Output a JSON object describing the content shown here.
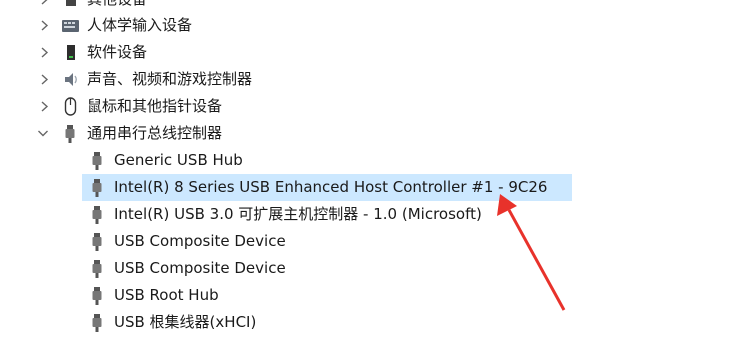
{
  "tree": {
    "categories": [
      {
        "label": "其他设备",
        "expanded": false,
        "icon": "device-icon"
      },
      {
        "label": "人体学输入设备",
        "expanded": false,
        "icon": "keyboard-icon"
      },
      {
        "label": "软件设备",
        "expanded": false,
        "icon": "software-device-icon"
      },
      {
        "label": "声音、视频和游戏控制器",
        "expanded": false,
        "icon": "speaker-icon"
      },
      {
        "label": "鼠标和其他指针设备",
        "expanded": false,
        "icon": "mouse-icon"
      },
      {
        "label": "通用串行总线控制器",
        "expanded": true,
        "icon": "usb-icon"
      }
    ],
    "usb_children": [
      {
        "label": "Generic USB Hub",
        "selected": false
      },
      {
        "label": "Intel(R) 8 Series USB Enhanced Host Controller #1 - 9C26",
        "selected": true
      },
      {
        "label": "Intel(R) USB 3.0 可扩展主机控制器 - 1.0 (Microsoft)",
        "selected": false
      },
      {
        "label": "USB Composite Device",
        "selected": false
      },
      {
        "label": "USB Composite Device",
        "selected": false
      },
      {
        "label": "USB Root Hub",
        "selected": false
      },
      {
        "label": "USB 根集线器(xHCI)",
        "selected": false
      }
    ]
  },
  "colors": {
    "selection": "#cce8ff",
    "annotation_arrow": "#e8322b"
  }
}
